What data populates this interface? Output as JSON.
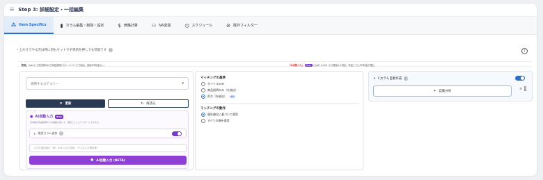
{
  "header": {
    "title": "Step 3: 詳細設定・一括編集"
  },
  "tabs": [
    {
      "label": "Item Specifics",
      "icon": "shapes-icon"
    },
    {
      "label": "カラム編集・削除・設定",
      "icon": "column-icon"
    },
    {
      "label": "価格計算",
      "icon": "dollar-icon"
    },
    {
      "label": "NA変換",
      "icon": "user-swap-icon"
    },
    {
      "label": "スケジュール",
      "icon": "clock-icon"
    },
    {
      "label": "除外フィルター",
      "icon": "filter-icon"
    }
  ],
  "note": "・上だけでやる方は特に何もセットせず更新を押しても可能です",
  "infobar": {
    "left_strong": "「更新」",
    "left_text": "Specにて完成済みから商品説明からルールベースで抽出。追加API料金なし。",
    "right_strong": "「AI自動入力」",
    "right_beta": "Beta",
    "right_text": "にはAI（LLM）から推奨より判定。商品ごとにAPI料金が発生。"
  },
  "left_panel": {
    "category_placeholder": "適用するカテゴリー",
    "update_label": "更新",
    "reload_label": "再読込",
    "ai": {
      "title": "AI自動入力",
      "beta": "Beta",
      "subtitle": "日本語の商品説明からAI推論を用いて、項目ごとにエクスポートされます。",
      "recommend_label": "推奨カラム追加",
      "recommend_on": true,
      "input_placeholder": "入力の追加指示（例：ボタンのマ名称、サイズ入力規定等）",
      "run_label": "AI自動入力 (BETA)"
    }
  },
  "mid_panel": {
    "matching_target_title": "マッチングの基準",
    "matching_targets": [
      {
        "label": "タイトルのみ",
        "selected": false,
        "badge": ""
      },
      {
        "label": "商品説明のみ（を抽出）",
        "selected": false,
        "badge": ""
      },
      {
        "label": "両方（を抽出）",
        "selected": true,
        "badge": "推奨"
      }
    ],
    "matching_action_title": "マッチングの動作",
    "matching_actions": [
      {
        "label": "優先順位に基づいて適用",
        "selected": true
      },
      {
        "label": "すべての値を適用",
        "selected": false
      }
    ]
  },
  "right_panel": {
    "title": "Cカラム自動作成",
    "toggle_on": true,
    "analyze_label": "自動分析",
    "detail_label": "詳細"
  }
}
